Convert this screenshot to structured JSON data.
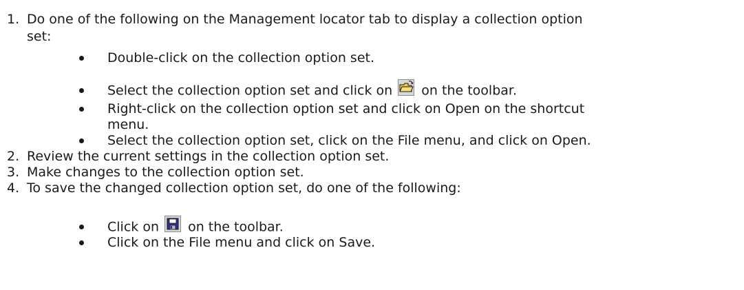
{
  "steps": [
    {
      "number": "1.",
      "text_line1": "Do one of the following on the Management locator tab to display a collection option",
      "text_line2": "set:",
      "bullets": [
        {
          "text": "Double-click on the collection option set."
        },
        {
          "text_before": "Select the collection option set and click on",
          "icon": "open-folder-icon",
          "text_after": "on the toolbar."
        },
        {
          "text_line1": "Right-click on the collection option set and click on Open on the shortcut",
          "text_line2": "menu."
        },
        {
          "text": "Select the collection option set, click on the File menu, and click on Open."
        }
      ]
    },
    {
      "number": "2.",
      "text": "Review the current settings in the collection option set."
    },
    {
      "number": "3.",
      "text": "Make changes to the collection option set."
    },
    {
      "number": "4.",
      "text": "To save the changed collection option set, do one of the following:",
      "bullets": [
        {
          "text_before": "Click on",
          "icon": "save-disk-icon",
          "text_after": "on the toolbar."
        },
        {
          "text": "Click on the File menu and click on Save."
        }
      ]
    }
  ],
  "colors": {
    "text": "#1a1a1a",
    "folder": "#f2c94c",
    "disk": "#2f2f8f"
  }
}
